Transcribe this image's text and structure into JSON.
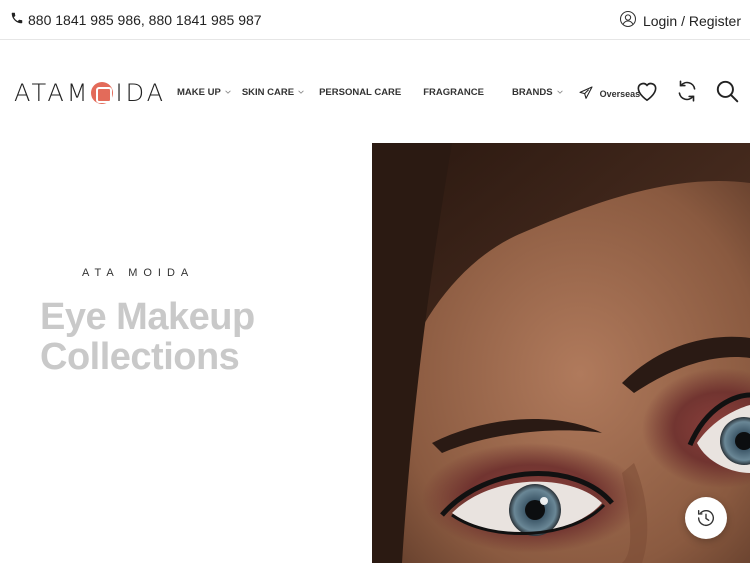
{
  "topbar": {
    "phone_icon": "phone-icon",
    "phone_numbers": "880 1841 985 986, 880 1841 985 987",
    "login_icon": "user-icon",
    "login_label": "Login / Register"
  },
  "header": {
    "logo_text_left": "ATAM",
    "logo_text_right": "IDA",
    "nav": [
      {
        "label": "MAKE UP",
        "has_dropdown": true
      },
      {
        "label": "SKIN CARE",
        "has_dropdown": true
      },
      {
        "label": "PERSONAL CARE",
        "has_dropdown": false
      },
      {
        "label": "FRAGRANCE",
        "has_dropdown": false
      },
      {
        "label": "BRANDS",
        "has_dropdown": true
      }
    ],
    "overseas_label": "Overseas",
    "overseas_icon": "airplane-icon",
    "wishlist_icon": "heart-icon",
    "compare_icon": "refresh-icon",
    "search_icon": "search-icon"
  },
  "hero": {
    "kicker": "ATA MOIDA",
    "title_line1": "Eye Makeup",
    "title_line2": "Collections",
    "image_subject": "close-up of woman's eyes with dark smoky eye makeup"
  },
  "floating": {
    "history_icon": "clock-icon"
  },
  "colors": {
    "logo_seal": "#e36b5a",
    "hero_title": "#c9c9c9",
    "text": "#222222"
  }
}
